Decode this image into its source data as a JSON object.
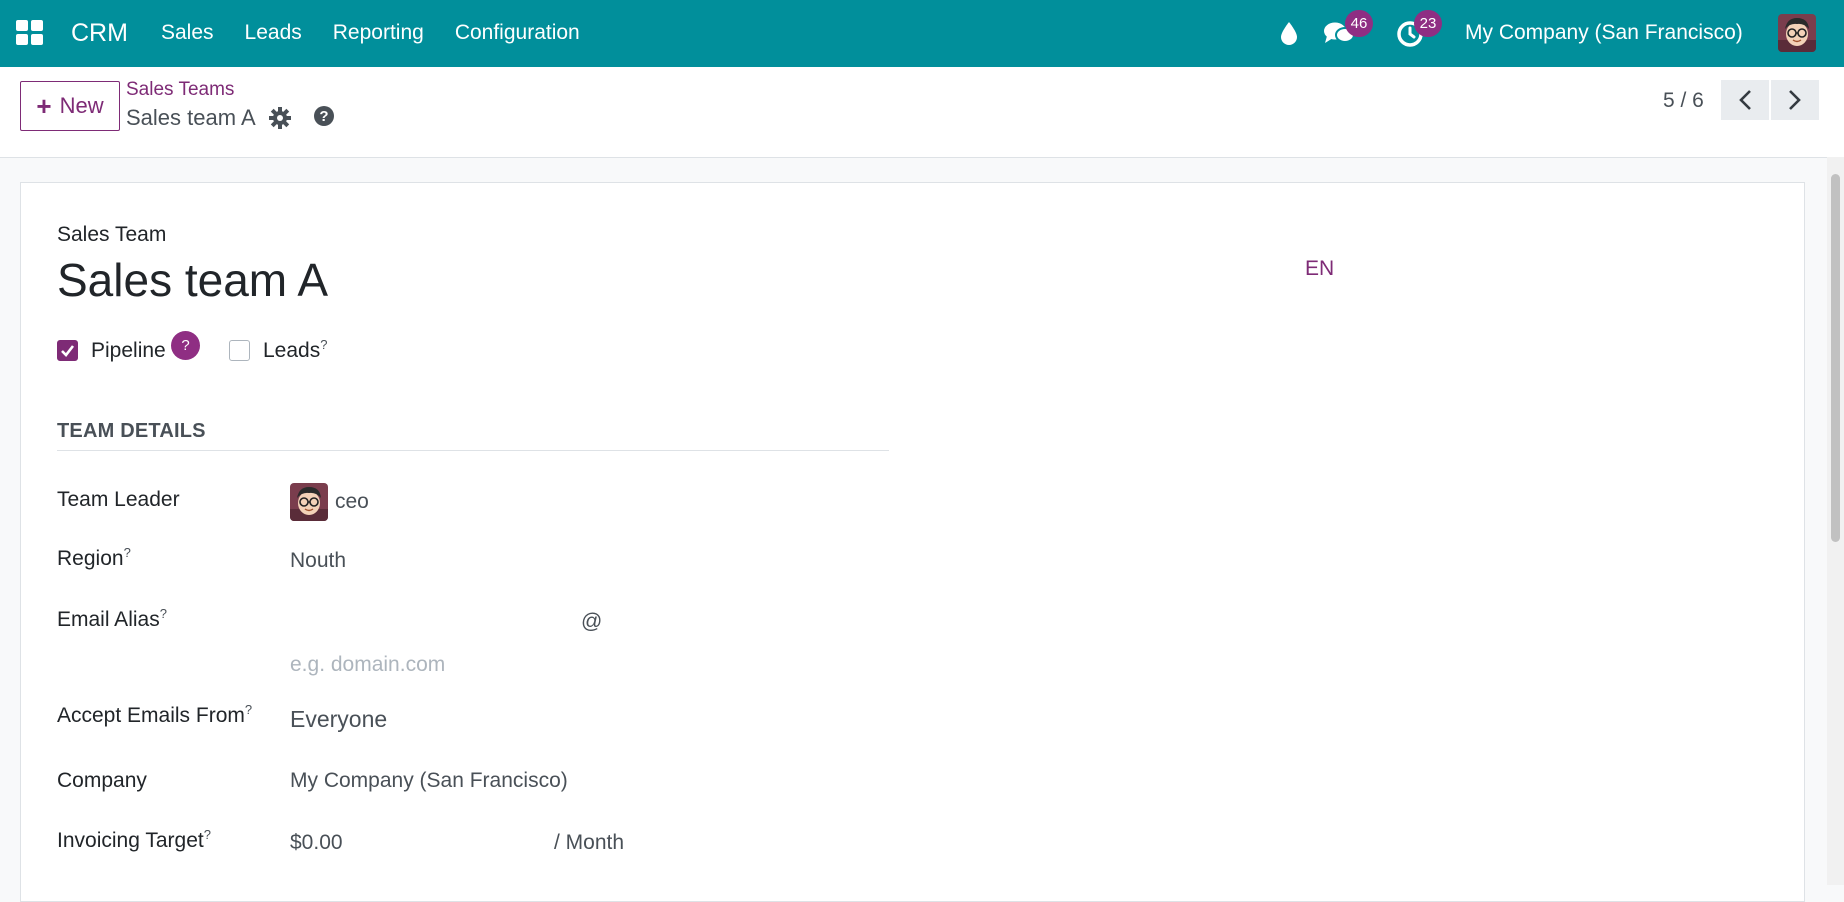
{
  "navbar": {
    "app_name": "CRM",
    "menu": [
      "Sales",
      "Leads",
      "Reporting",
      "Configuration"
    ],
    "icons": [
      "apps-grid-icon",
      "droplet-icon",
      "chat-icon",
      "clock-icon"
    ],
    "messages_count": "46",
    "activities_count": "23",
    "company": "My Company (San Francisco)",
    "accent": "#018f9b"
  },
  "control_panel": {
    "new_label": "New",
    "breadcrumb_parent": "Sales Teams",
    "breadcrumb_current": "Sales team A",
    "pager": "5 / 6"
  },
  "form": {
    "model_label": "Sales Team",
    "name": "Sales team A",
    "lang": "EN",
    "pipeline_label": "Pipeline",
    "pipeline_checked": true,
    "help_bubble": "?",
    "leads_label": "Leads",
    "leads_checked": false,
    "help_mark": "?",
    "section_title": "TEAM DETAILS",
    "fields": {
      "team_leader": {
        "label": "Team Leader",
        "value": "ceo"
      },
      "region": {
        "label": "Region",
        "value": "Nouth"
      },
      "email_alias": {
        "label": "Email Alias",
        "at": "@",
        "domain_placeholder": "e.g. domain.com"
      },
      "accept_emails": {
        "label": "Accept Emails From",
        "value": "Everyone"
      },
      "company": {
        "label": "Company",
        "value": "My Company (San Francisco)"
      },
      "invoicing_target": {
        "label": "Invoicing Target",
        "value": "$0.00",
        "unit": "/ Month"
      }
    },
    "brand_color": "#7e2b76"
  }
}
